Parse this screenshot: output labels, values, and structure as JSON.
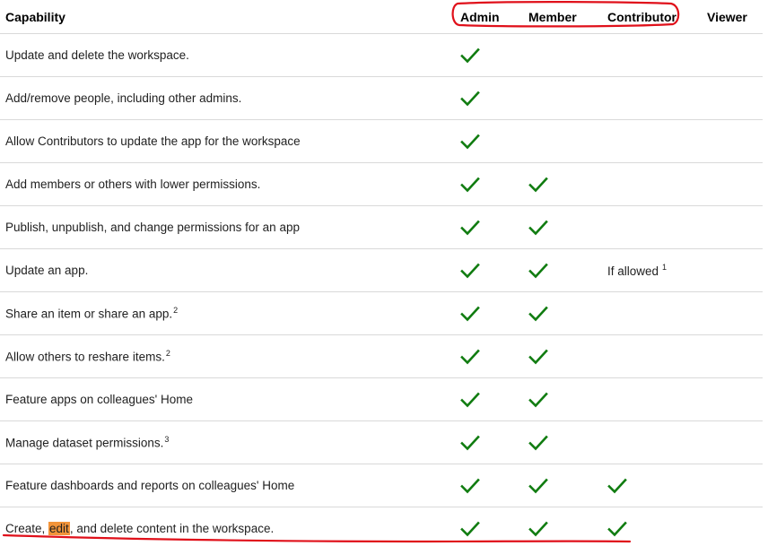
{
  "table": {
    "headers": {
      "capability": "Capability",
      "admin": "Admin",
      "member": "Member",
      "contributor": "Contributor",
      "viewer": "Viewer"
    },
    "rows": [
      {
        "capability": "Update and delete the workspace.",
        "footnote": "",
        "admin": true,
        "member": false,
        "contributor": false,
        "contributor_text": "",
        "contributor_footnote": "",
        "viewer": false
      },
      {
        "capability": "Add/remove people, including other admins.",
        "footnote": "",
        "admin": true,
        "member": false,
        "contributor": false,
        "contributor_text": "",
        "contributor_footnote": "",
        "viewer": false
      },
      {
        "capability": "Allow Contributors to update the app for the workspace",
        "footnote": "",
        "admin": true,
        "member": false,
        "contributor": false,
        "contributor_text": "",
        "contributor_footnote": "",
        "viewer": false
      },
      {
        "capability": "Add members or others with lower permissions.",
        "footnote": "",
        "admin": true,
        "member": true,
        "contributor": false,
        "contributor_text": "",
        "contributor_footnote": "",
        "viewer": false
      },
      {
        "capability": "Publish, unpublish, and change permissions for an app",
        "footnote": "",
        "admin": true,
        "member": true,
        "contributor": false,
        "contributor_text": "",
        "contributor_footnote": "",
        "viewer": false
      },
      {
        "capability": "Update an app.",
        "footnote": "",
        "admin": true,
        "member": true,
        "contributor": false,
        "contributor_text": "If allowed",
        "contributor_footnote": "1",
        "viewer": false
      },
      {
        "capability": "Share an item or share an app.",
        "footnote": "2",
        "admin": true,
        "member": true,
        "contributor": false,
        "contributor_text": "",
        "contributor_footnote": "",
        "viewer": false
      },
      {
        "capability": "Allow others to reshare items.",
        "footnote": "2",
        "admin": true,
        "member": true,
        "contributor": false,
        "contributor_text": "",
        "contributor_footnote": "",
        "viewer": false
      },
      {
        "capability": "Feature apps on colleagues' Home",
        "footnote": "",
        "admin": true,
        "member": true,
        "contributor": false,
        "contributor_text": "",
        "contributor_footnote": "",
        "viewer": false
      },
      {
        "capability": "Manage dataset permissions.",
        "footnote": "3",
        "admin": true,
        "member": true,
        "contributor": false,
        "contributor_text": "",
        "contributor_footnote": "",
        "viewer": false
      },
      {
        "capability": "Feature dashboards and reports on colleagues' Home",
        "footnote": "",
        "admin": true,
        "member": true,
        "contributor": true,
        "contributor_text": "",
        "contributor_footnote": "",
        "viewer": false
      },
      {
        "capability": "",
        "capability_parts": {
          "before": "Create, ",
          "highlight": "edit",
          "after": ", and delete content in the workspace."
        },
        "footnote": "",
        "admin": true,
        "member": true,
        "contributor": true,
        "contributor_text": "",
        "contributor_footnote": "",
        "viewer": false
      }
    ]
  },
  "icons": {
    "check": "checkmark-icon"
  },
  "colors": {
    "check_green": "#107c10",
    "highlight_orange": "#f2943a",
    "annotation_red": "#e0101a",
    "row_divider": "#d9d9d9"
  }
}
